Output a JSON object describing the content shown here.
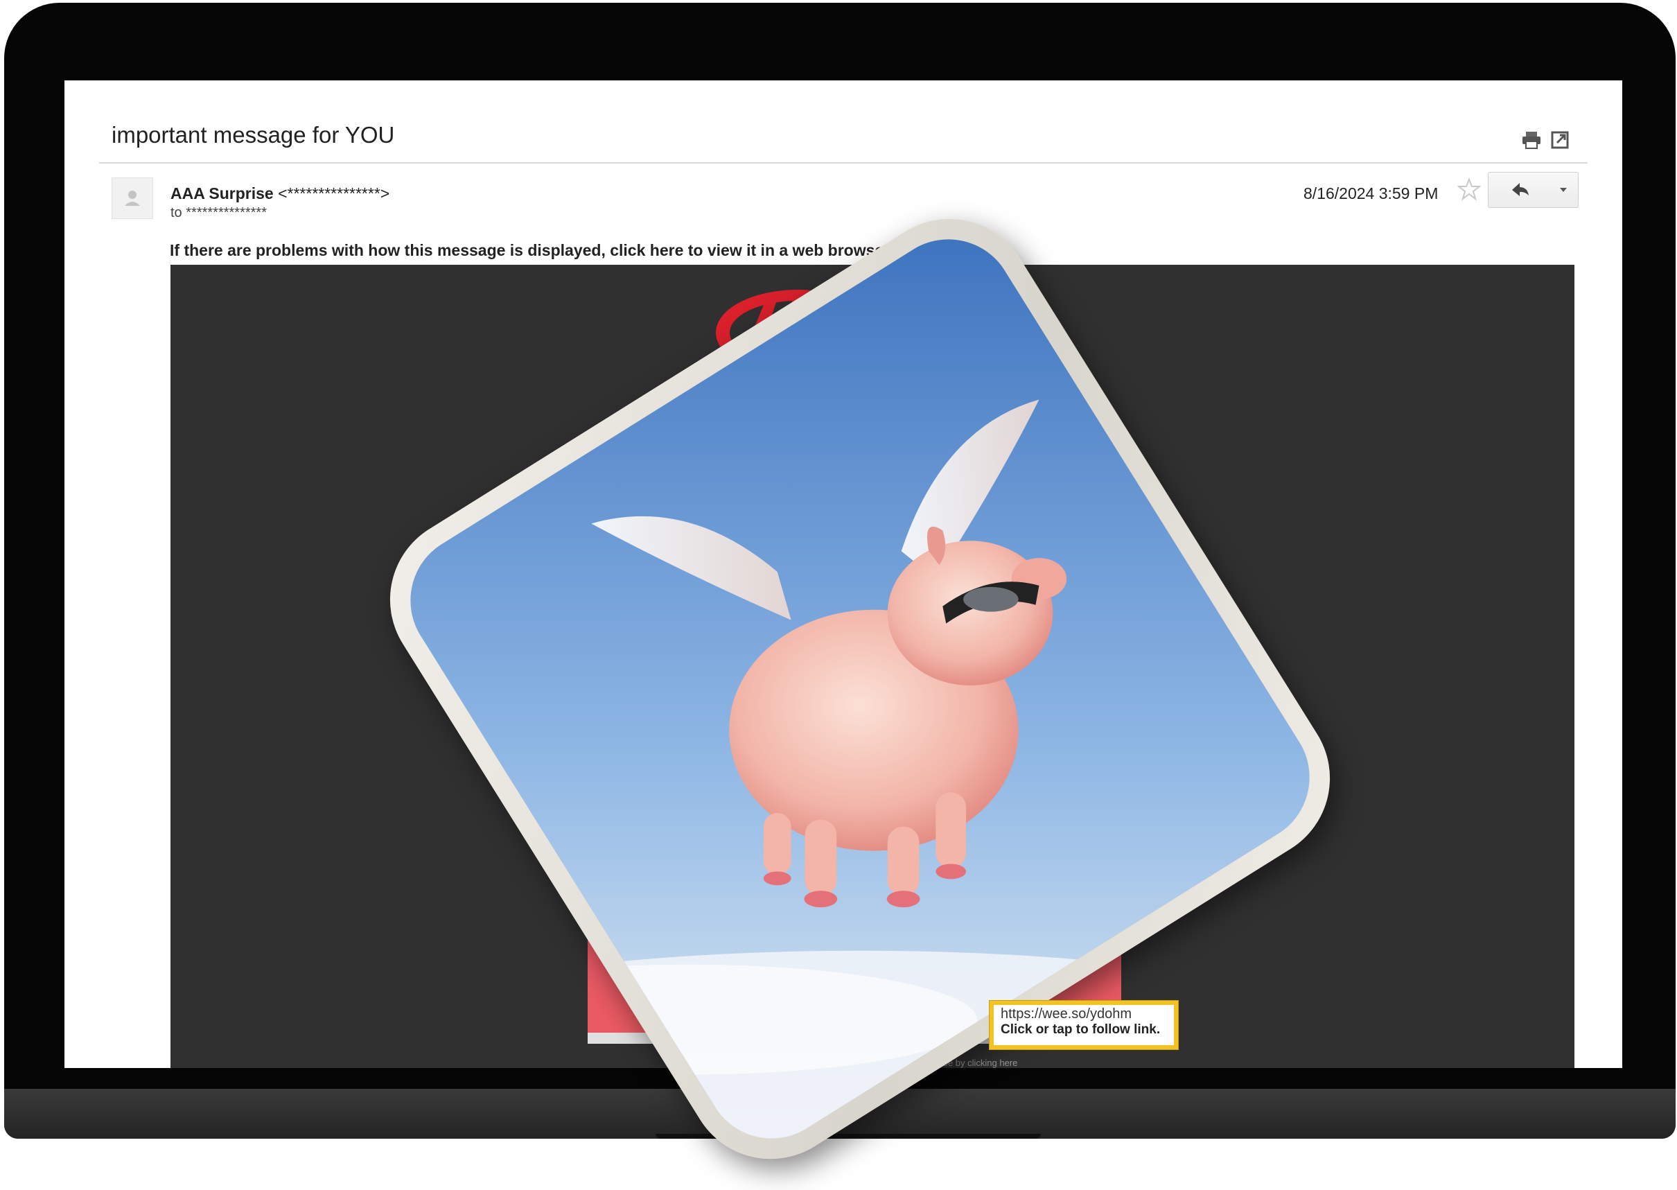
{
  "email": {
    "subject": "important message for YOU",
    "sender_name": "AAA Surprise",
    "sender_address": "<***************>",
    "to_label": "to",
    "recipient": "***************",
    "date": "8/16/2024 3:59 PM",
    "view_in_browser_notice": "If there are problems with how this message is displayed, click here to view it in a web browser.",
    "footer_text": "ubscribe by clicking here"
  },
  "icons": {
    "print": "print-icon",
    "popout": "popout-icon",
    "star": "star-icon",
    "reply": "reply-icon",
    "more": "chevron-down-icon",
    "avatar": "person-icon",
    "logo": "aaa-logo"
  },
  "tooltip": {
    "url": "https://wee.so/ydohm",
    "hint": "Click or tap to follow link."
  },
  "colors": {
    "email_body_bg": "#303030",
    "brand_red": "#d9202b",
    "banner_red": "#ea5a63",
    "tooltip_border": "#f2c322"
  }
}
